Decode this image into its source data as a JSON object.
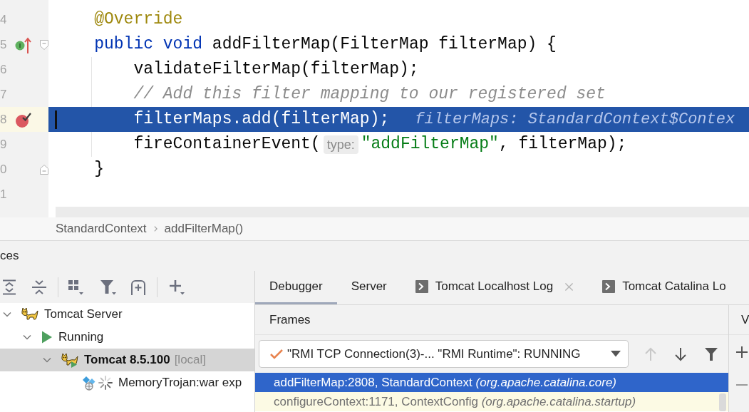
{
  "editor": {
    "lines": [
      {
        "number": "4",
        "current": false,
        "parts": [
          {
            "kind": "code",
            "tokens": [
              {
                "kind": "annotation",
                "text": "@Override"
              }
            ]
          }
        ]
      },
      {
        "number": "5",
        "current": false,
        "gutter_marker": {
          "kind": "implements"
        },
        "fold_marker": {
          "kind": "start"
        },
        "parts": [
          {
            "kind": "code",
            "tokens": [
              {
                "kind": "keyword",
                "text": "public void"
              },
              {
                "kind": "plain",
                "text": " addFilterMap(FilterMap filterMap) {"
              }
            ]
          }
        ],
        "children": [
          {
            "number": "6",
            "current": false,
            "parts": [
              {
                "kind": "code",
                "tokens": [
                  {
                    "kind": "plain",
                    "text": "validateFilterMap(filterMap);"
                  }
                ]
              }
            ]
          },
          {
            "number": "7",
            "current": false,
            "parts": [
              {
                "kind": "code",
                "tokens": [
                  {
                    "kind": "comment",
                    "text": "// Add this filter mapping to our registered set"
                  }
                ]
              }
            ]
          },
          {
            "number": "8",
            "current": true,
            "gutter_marker": {
              "kind": "breakpoint"
            },
            "parts": [
              {
                "kind": "code",
                "tokens": [
                  {
                    "kind": "plain",
                    "text": "filterMaps.add(filterMap);"
                  }
                ]
              },
              {
                "kind": "value_hint",
                "text": "filterMaps: StandardContext$Contex"
              }
            ]
          },
          {
            "number": "9",
            "current": false,
            "parts": [
              {
                "kind": "code",
                "tokens": [
                  {
                    "kind": "plain",
                    "text": "fireContainerEvent("
                  }
                ]
              },
              {
                "kind": "parameter_hint",
                "text": "type:"
              },
              {
                "kind": "code",
                "tokens": [
                  {
                    "kind": "string",
                    "text": "\"addFilterMap\""
                  },
                  {
                    "kind": "plain",
                    "text": ", filterMap);"
                  }
                ]
              }
            ]
          }
        ]
      },
      {
        "number": "0",
        "current": false,
        "fold_marker": {
          "kind": "end"
        },
        "parts": [
          {
            "kind": "code",
            "tokens": [
              {
                "kind": "plain",
                "text": "}"
              }
            ]
          }
        ]
      },
      {
        "number": "1",
        "current": false
      }
    ]
  },
  "breadcrumbs": [
    {
      "label": "StandardContext"
    },
    {
      "label": "addFilterMap()"
    }
  ],
  "services": {
    "title": "ces",
    "tree": [
      {
        "label": "Tomcat Server",
        "kind": "server",
        "expanded": true,
        "selected": false,
        "children": [
          {
            "label": "Running",
            "kind": "status",
            "expanded": true,
            "selected": false,
            "children": [
              {
                "label": "Tomcat 8.5.100",
                "suffix": "[local]",
                "kind": "instance",
                "expanded": true,
                "selected": true,
                "children": [
                  {
                    "label": "MemoryTrojan:war exp",
                    "kind": "artifact",
                    "deploying": true,
                    "selected": false
                  }
                ]
              }
            ]
          }
        ]
      }
    ]
  },
  "debugger": {
    "tabs": [
      {
        "label": "Debugger",
        "kind": "plain",
        "selected": true,
        "closable": false
      },
      {
        "label": "Server",
        "kind": "plain",
        "selected": false,
        "closable": false
      },
      {
        "label": "Tomcat Localhost Log",
        "kind": "log",
        "selected": false,
        "closable": true
      },
      {
        "label": "Tomcat Catalina Lo",
        "kind": "log",
        "selected": false,
        "closable": false
      }
    ],
    "frames": {
      "title": "Frames",
      "thread": "\"RMI TCP Connection(3)-... \"RMI Runtime\": RUNNING",
      "controls": [
        {
          "kind": "up",
          "disabled": true
        },
        {
          "kind": "down",
          "disabled": false
        },
        {
          "kind": "filter",
          "disabled": false
        }
      ],
      "rows": [
        {
          "text": "addFilterMap:2808, StandardContext *(org.apache.catalina.core)*",
          "selected": true,
          "library": false
        },
        {
          "text": "configureContext:1171, ContextConfig *(org.apache.catalina.startup)*",
          "selected": false,
          "library": true
        }
      ]
    },
    "variables": {
      "title": "V"
    }
  }
}
